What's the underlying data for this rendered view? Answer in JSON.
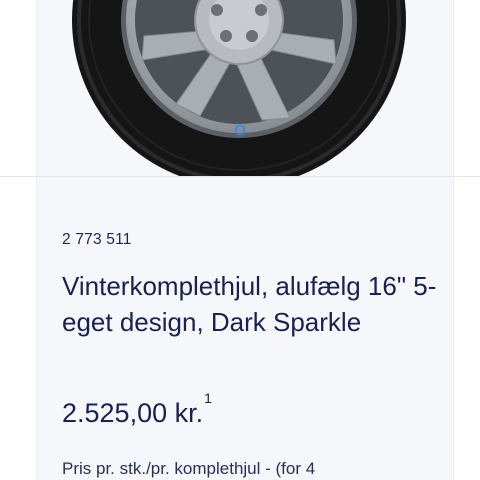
{
  "product": {
    "article_number": "2 773 511",
    "title": "Vinterkomplethjul, alufælg 16\" 5-eget design, Dark Sparkle",
    "price": "2.525,00 kr.",
    "price_footnote": "1",
    "price_note": "Pris pr. stk./pr. komplethjul - (for 4"
  },
  "colors": {
    "text": "#1a2050",
    "card_background": "#f6f7fb",
    "rim": "#9aa0a6",
    "tire": "#151515",
    "valve_ring": "#2a86ff"
  },
  "icons": {
    "product_image": "wheel-image"
  }
}
